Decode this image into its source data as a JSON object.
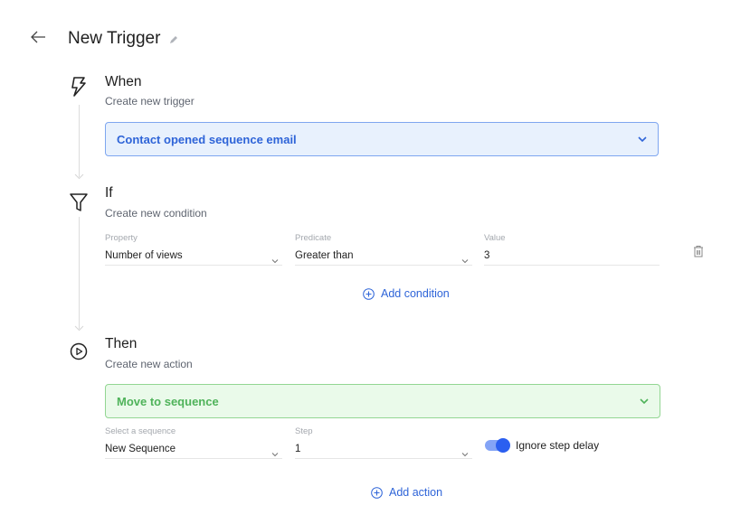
{
  "header": {
    "title": "New Trigger",
    "back_icon": "arrow-left-icon",
    "edit_icon": "pencil-icon"
  },
  "when": {
    "icon": "lightning-icon",
    "title": "When",
    "subtitle": "Create new trigger",
    "trigger_value": "Contact opened sequence email"
  },
  "if": {
    "icon": "filter-icon",
    "title": "If",
    "subtitle": "Create new condition",
    "condition": {
      "property_label": "Property",
      "property_value": "Number of views",
      "predicate_label": "Predicate",
      "predicate_value": "Greater than",
      "value_label": "Value",
      "value_value": "3"
    },
    "delete_icon": "trash-icon",
    "add_condition_label": "Add condition"
  },
  "then": {
    "icon": "play-circle-icon",
    "title": "Then",
    "subtitle": "Create new action",
    "action_value": "Move to sequence",
    "sequence_label": "Select a sequence",
    "sequence_value": "New Sequence",
    "step_label": "Step",
    "step_value": "1",
    "ignore_delay_label": "Ignore step delay",
    "ignore_delay_on": true,
    "add_action_label": "Add action"
  },
  "colors": {
    "accent_blue": "#2e64d8",
    "trigger_bg": "#e8f1fd",
    "action_green": "#4fb35a",
    "action_bg": "#eafaea",
    "toggle_on": "#2b5ff0"
  }
}
